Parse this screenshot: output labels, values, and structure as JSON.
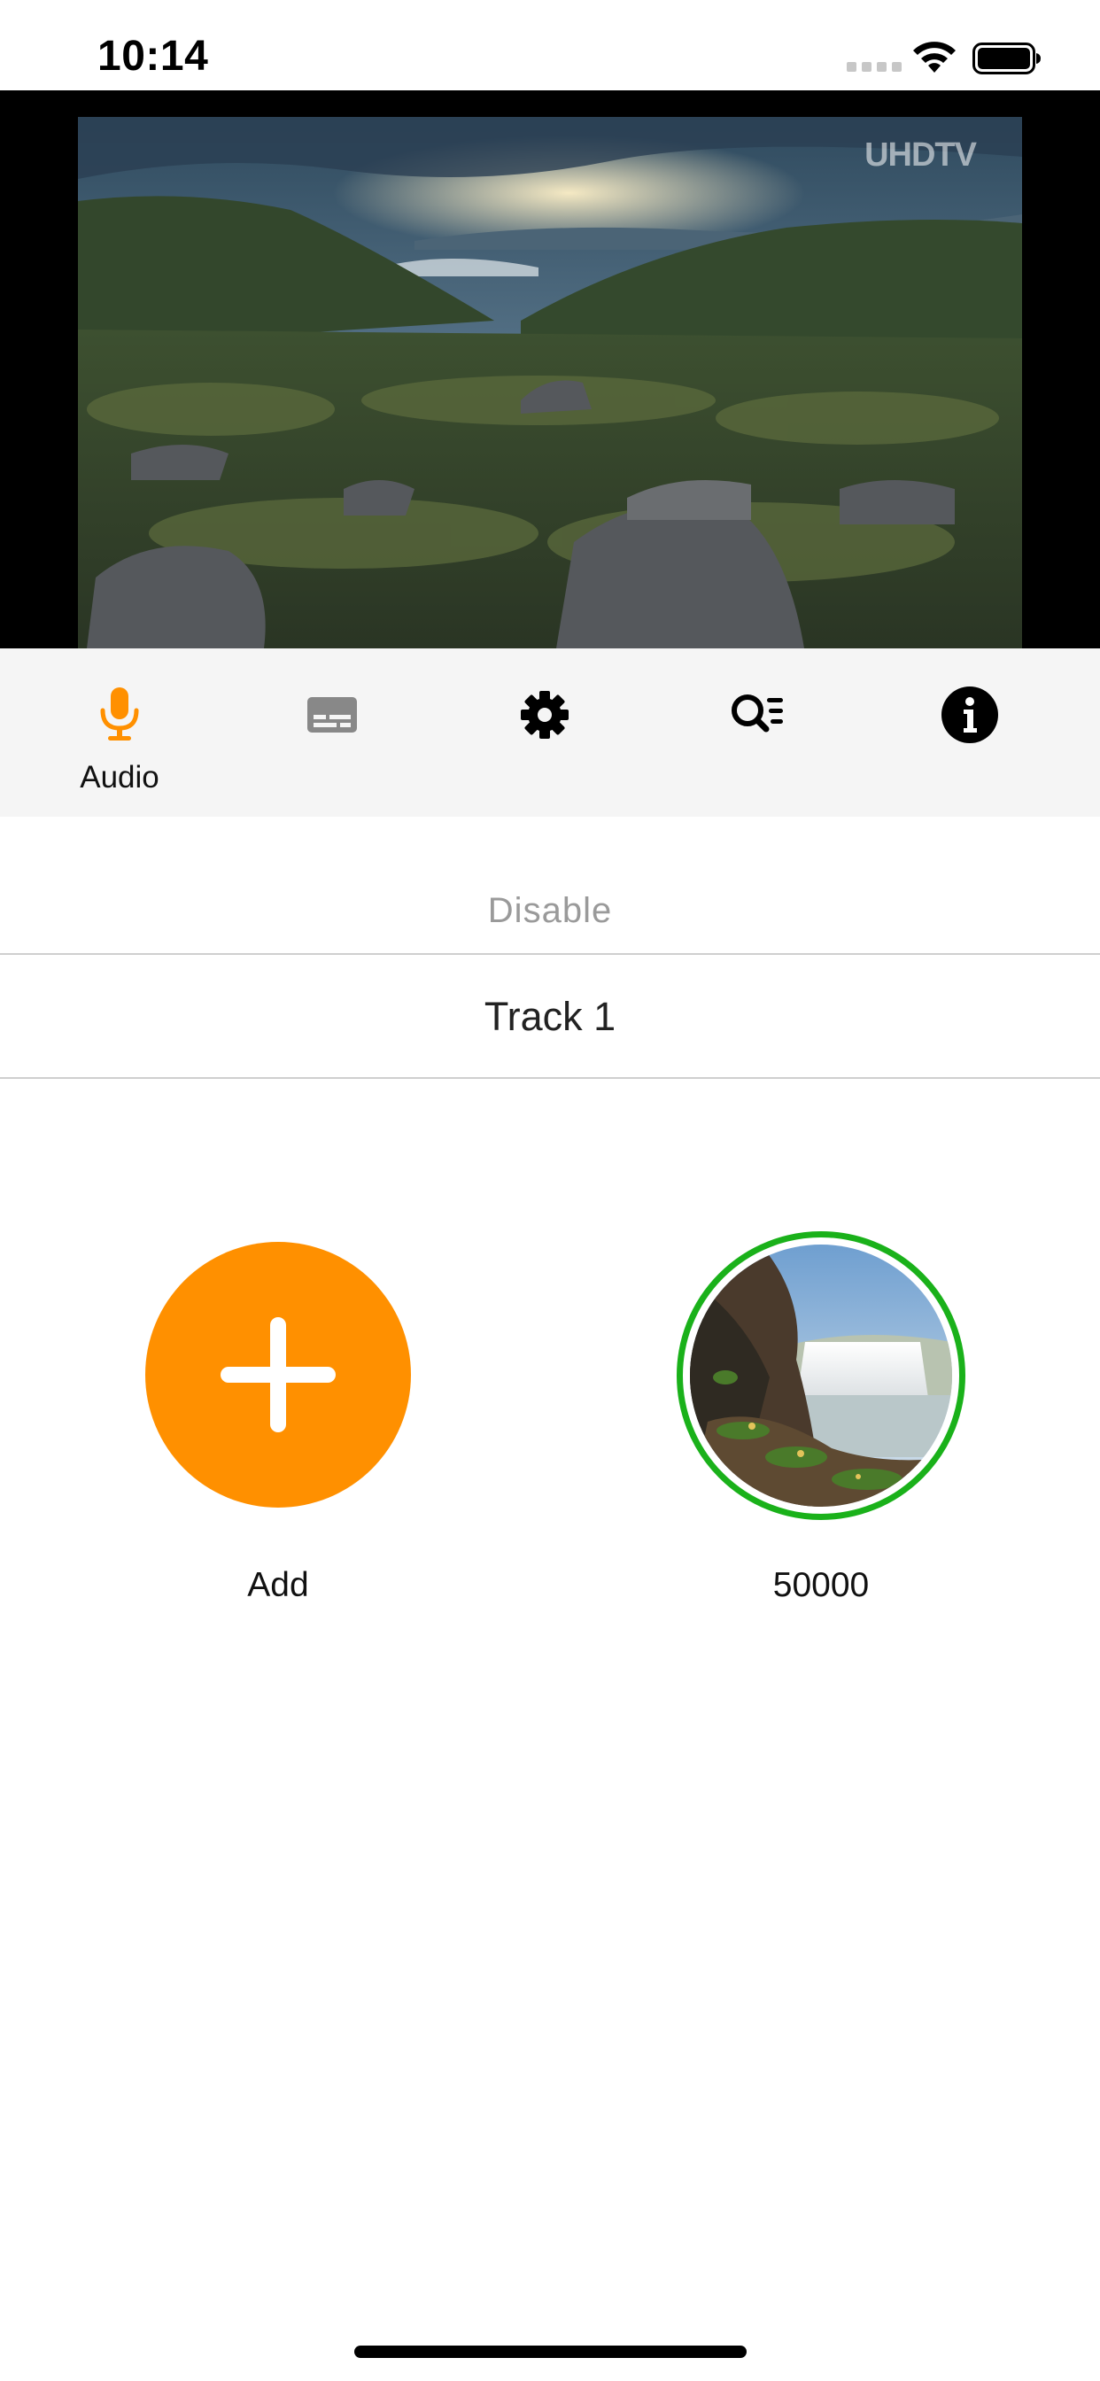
{
  "status_bar": {
    "time": "10:14"
  },
  "video": {
    "watermark": "UHDTV"
  },
  "tabs": [
    {
      "id": "audio",
      "label": "Audio",
      "icon": "microphone-icon",
      "active": true
    },
    {
      "id": "subtitles",
      "label": "",
      "icon": "subtitles-icon",
      "active": false
    },
    {
      "id": "settings",
      "label": "",
      "icon": "gear-icon",
      "active": false
    },
    {
      "id": "search",
      "label": "",
      "icon": "search-list-icon",
      "active": false
    },
    {
      "id": "info",
      "label": "",
      "icon": "info-icon",
      "active": false
    }
  ],
  "audio_tracks": [
    {
      "label": "Disable",
      "selected": false
    },
    {
      "label": "Track 1",
      "selected": true
    }
  ],
  "grid": {
    "add_label": "Add",
    "items": [
      {
        "label": "50000",
        "selected": true
      }
    ]
  },
  "colors": {
    "accent": "#ff9000",
    "selected_ring": "#1ab11a",
    "tab_bar_bg": "#f5f5f5",
    "inactive_icon": "#888888"
  }
}
